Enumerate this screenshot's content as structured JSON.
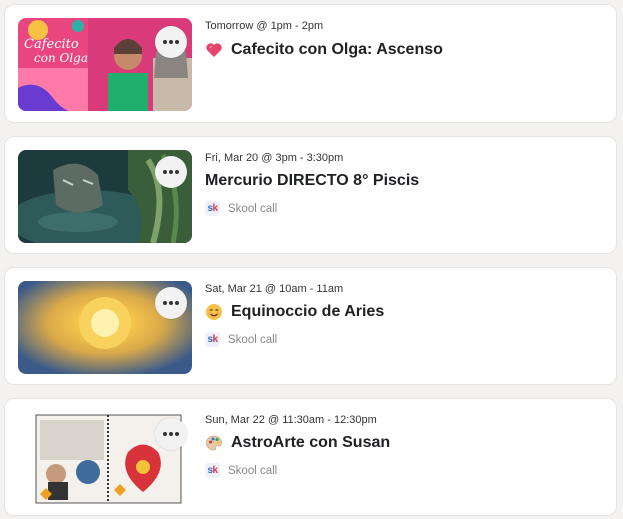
{
  "events": [
    {
      "date": "Tomorrow @ 1pm - 2pm",
      "title": "Cafecito con Olga: Ascenso",
      "emoji_icon": "heart-icon",
      "thumbnail_text_1": "Cafecito",
      "thumbnail_text_2": "con Olga",
      "call_label": ""
    },
    {
      "date": "Fri, Mar 20 @ 3pm - 3:30pm",
      "title": "Mercurio DIRECTO 8° Piscis",
      "emoji_icon": "",
      "call_label": "Skool call"
    },
    {
      "date": "Sat, Mar 21 @ 10am - 11am",
      "title": "Equinoccio de Aries",
      "emoji_icon": "smiling-face-icon",
      "call_label": "Skool call"
    },
    {
      "date": "Sun, Mar 22 @ 11:30am - 12:30pm",
      "title": "AstroArte con Susan",
      "emoji_icon": "artist-palette-icon",
      "call_label": "Skool call"
    }
  ],
  "skool_icon": {
    "s": "s",
    "k": "k"
  },
  "colors": {
    "page_bg": "#f3f2f0",
    "card_bg": "#ffffff",
    "skool_s": "#2e6fdb",
    "skool_k": "#e2363f",
    "heart": "#e8436a"
  }
}
